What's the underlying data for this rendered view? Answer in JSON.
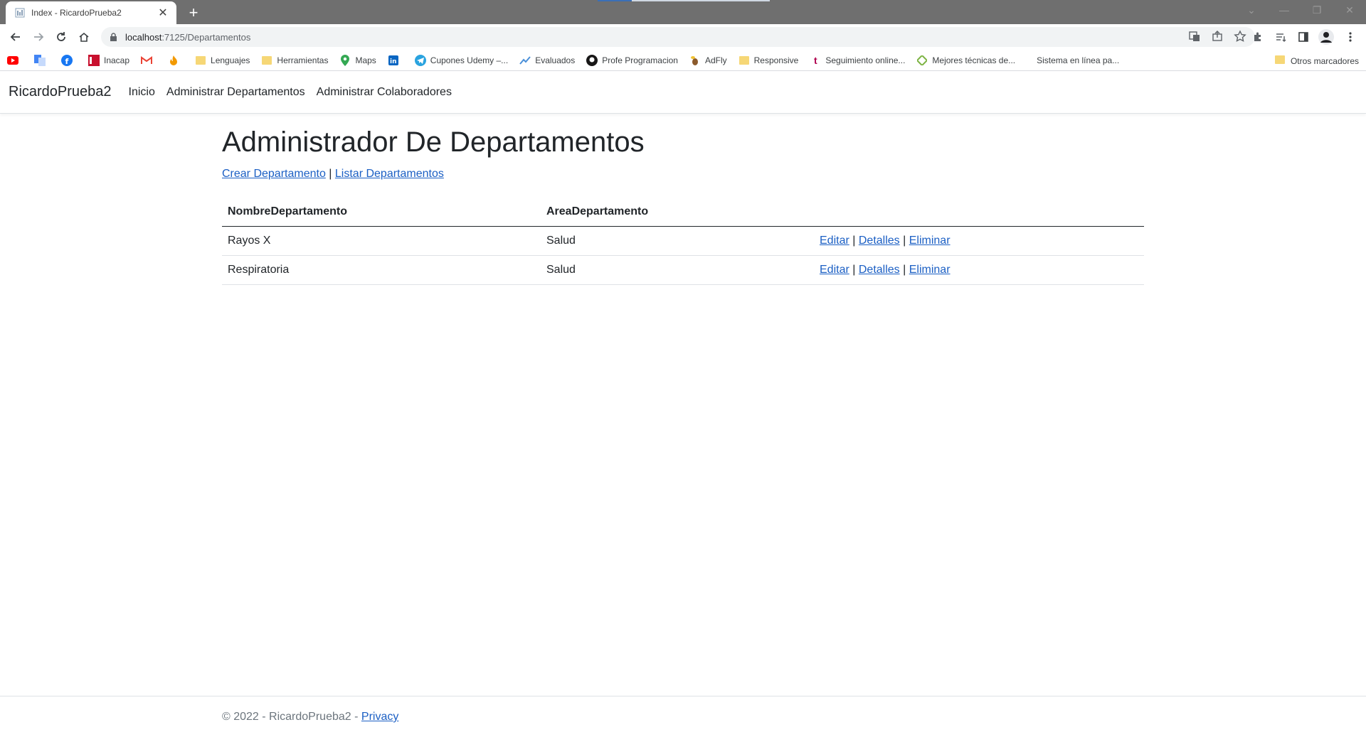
{
  "browser": {
    "tab_title": "Index - RicardoPrueba2",
    "url_host": "localhost",
    "url_path": ":7125/Departamentos",
    "bookmarks": [
      {
        "label": "",
        "icon": "youtube-icon"
      },
      {
        "label": "",
        "icon": "translate-icon"
      },
      {
        "label": "",
        "icon": "facebook-icon"
      },
      {
        "label": "Inacap",
        "icon": "inacap-icon"
      },
      {
        "label": "",
        "icon": "gmail-icon"
      },
      {
        "label": "",
        "icon": "flame-icon"
      },
      {
        "label": "Lenguajes",
        "icon": "folder-icon"
      },
      {
        "label": "Herramientas",
        "icon": "folder-icon"
      },
      {
        "label": "Maps",
        "icon": "maps-icon"
      },
      {
        "label": "",
        "icon": "linkedin-icon"
      },
      {
        "label": "Cupones Udemy –...",
        "icon": "telegram-icon"
      },
      {
        "label": "Evaluados",
        "icon": "chart-icon"
      },
      {
        "label": "Profe Programacion",
        "icon": "github-icon"
      },
      {
        "label": "AdFly",
        "icon": "adfly-icon"
      },
      {
        "label": "Responsive",
        "icon": "folder-icon"
      },
      {
        "label": "Seguimiento online...",
        "icon": "t-icon"
      },
      {
        "label": "Mejores técnicas de...",
        "icon": "diamond-icon"
      },
      {
        "label": "Sistema en línea pa...",
        "icon": "blank-icon"
      }
    ],
    "other_bookmarks": "Otros marcadores"
  },
  "site": {
    "brand": "RicardoPrueba2",
    "nav": [
      "Inicio",
      "Administrar Departamentos",
      "Administrar Colaboradores"
    ]
  },
  "main": {
    "title": "Administrador De Departamentos",
    "create_link": "Crear Departamento",
    "separator": "|",
    "list_link": "Listar Departamentos",
    "table": {
      "headers": [
        "NombreDepartamento",
        "AreaDepartamento"
      ],
      "rows": [
        {
          "nombre": "Rayos X",
          "area": "Salud"
        },
        {
          "nombre": "Respiratoria",
          "area": "Salud"
        }
      ],
      "row_actions": [
        "Editar",
        "Detalles",
        "Eliminar"
      ]
    }
  },
  "footer": {
    "text": "© 2022 - RicardoPrueba2 - ",
    "privacy": "Privacy"
  },
  "colors": {
    "link": "#1b5fc4",
    "tabstrip": "#6f6f6f",
    "text": "#212529"
  }
}
